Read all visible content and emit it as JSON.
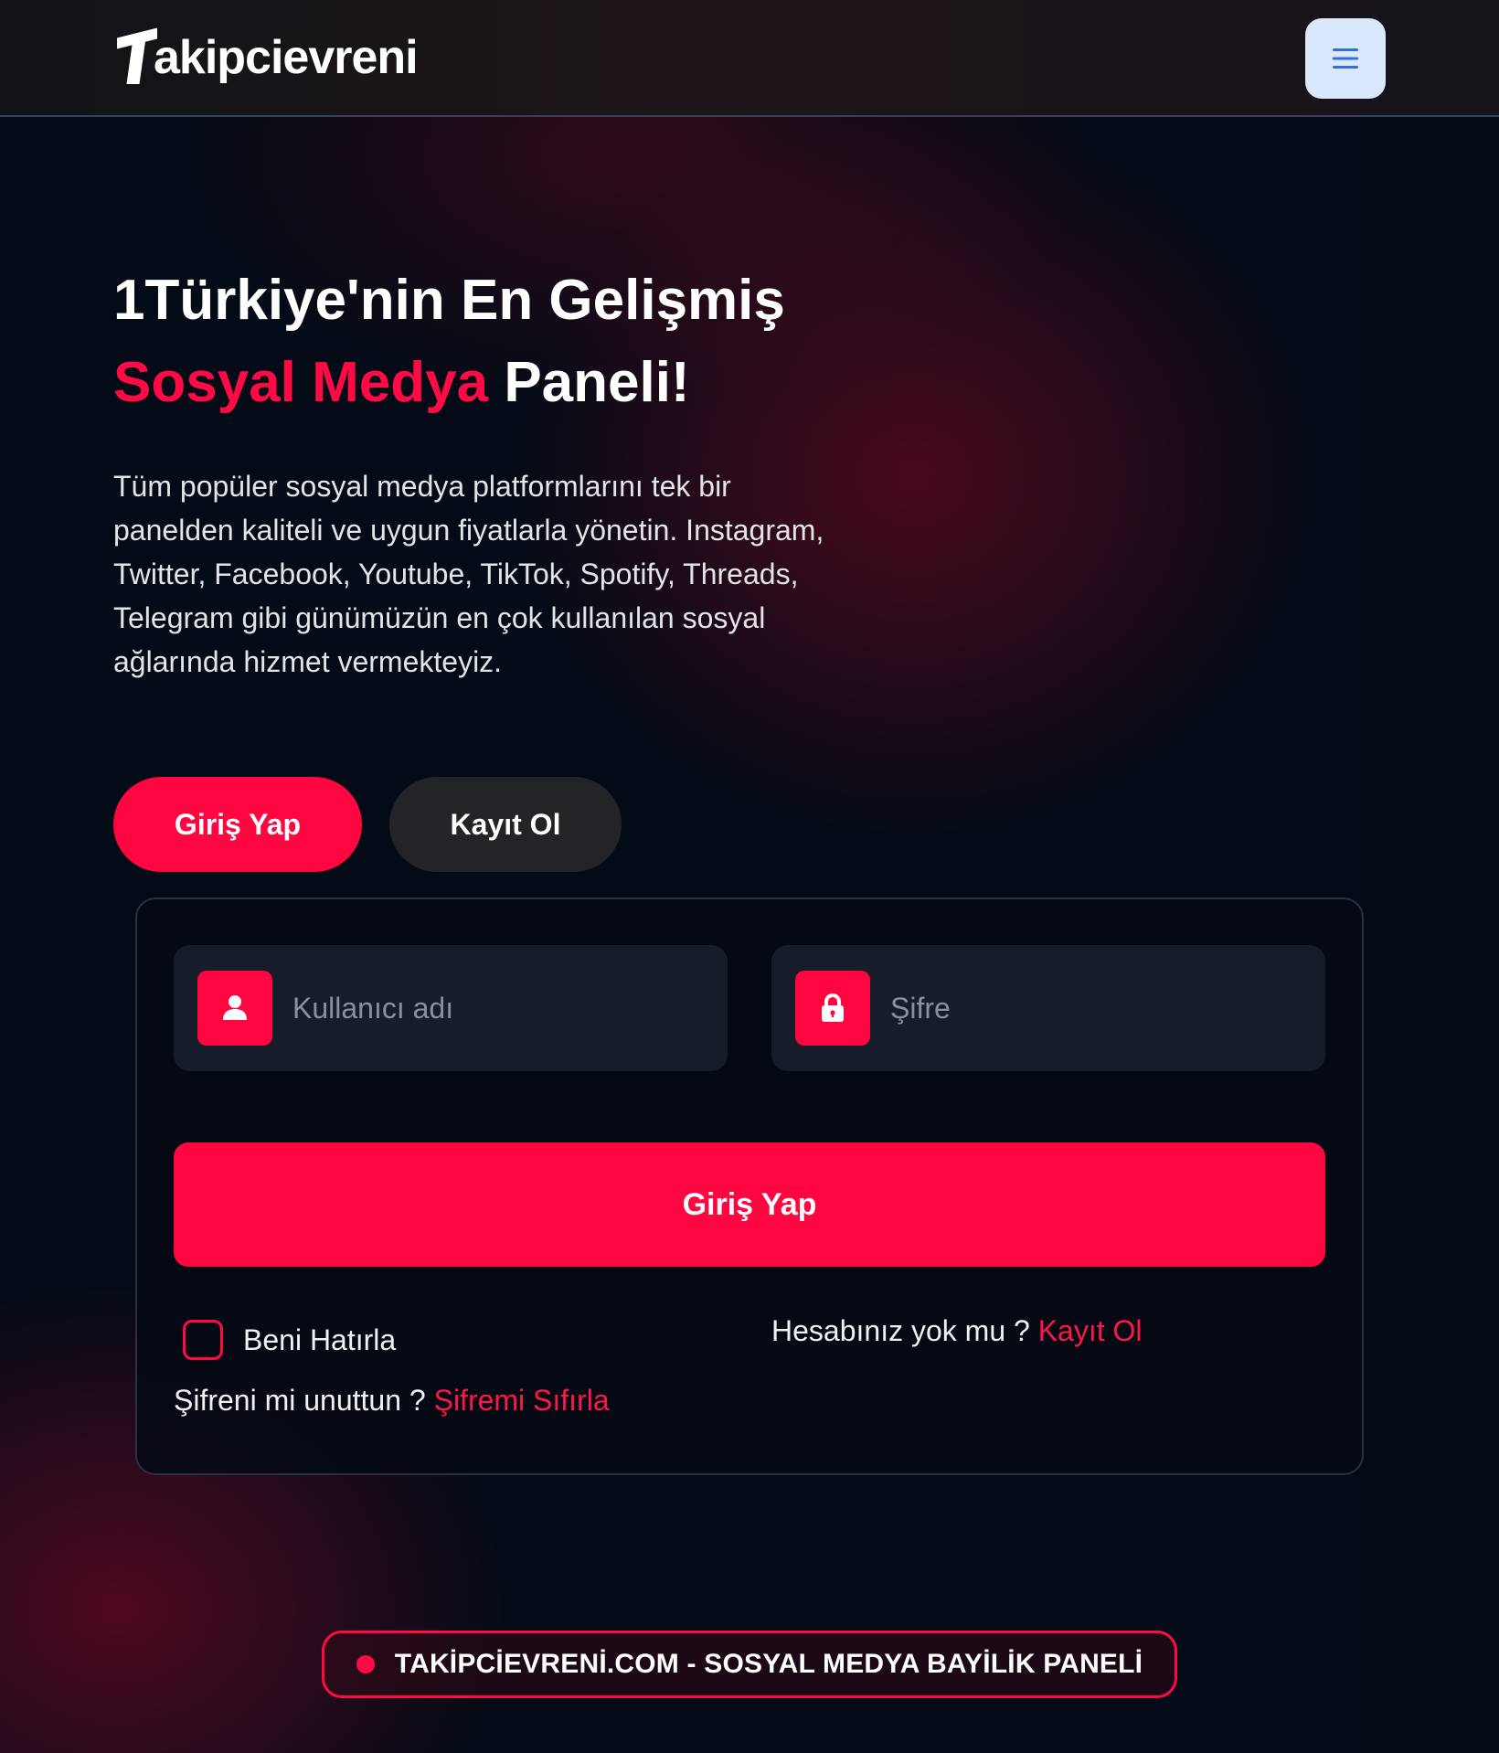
{
  "header": {
    "logo_text": "akipcievreni",
    "menu_icon": "hamburger-icon"
  },
  "hero": {
    "title_line1": "1Türkiye'nin En Gelişmiş",
    "title_accent": "Sosyal Medya",
    "title_rest": " Paneli!",
    "description": "Tüm popüler sosyal medya platformlarını tek bir panelden kaliteli ve uygun fiyatlarla yönetin. Instagram, Twitter, Facebook, Youtube, TikTok, Spotify, Threads, Telegram gibi günümüzün en çok kullanılan sosyal ağlarında hizmet vermekteyiz."
  },
  "tabs": {
    "login_label": "Giriş Yap",
    "register_label": "Kayıt Ol"
  },
  "form": {
    "username_placeholder": "Kullanıcı adı",
    "password_placeholder": "Şifre",
    "username_icon": "user-icon",
    "password_icon": "lock-icon",
    "submit_label": "Giriş Yap",
    "remember_label": "Beni Hatırla",
    "no_account_text": "Hesabınız yok mu ? ",
    "register_link": "Kayıt Ol",
    "forgot_text": "Şifreni mi unuttun ? ",
    "reset_link": "Şifremi Sıfırla"
  },
  "footer": {
    "badge_text": "TAKİPCİEVRENİ.COM - SOSYAL MEDYA BAYİLİK PANELİ"
  },
  "colors": {
    "accent": "#ff0640",
    "background": "#050b16",
    "field_bg": "#171d28",
    "menu_button": "#d9e8fc"
  }
}
